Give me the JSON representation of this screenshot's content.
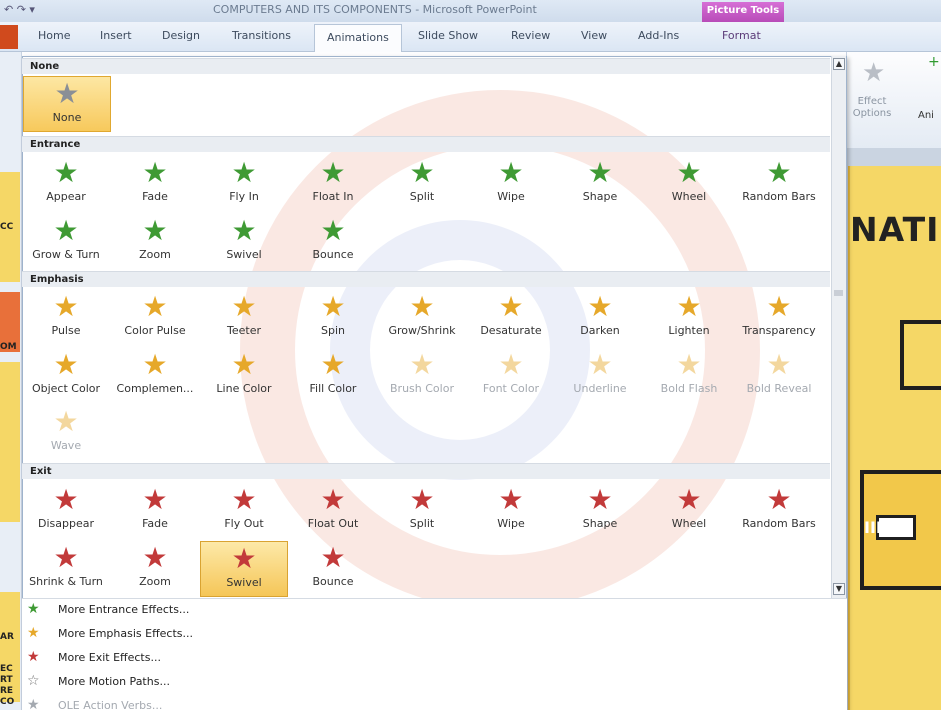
{
  "window": {
    "title": "COMPUTERS AND ITS COMPONENTS - Microsoft PowerPoint",
    "quick_access": "↶ ↷ ▾"
  },
  "context_tab": "Picture Tools",
  "tabs": [
    "Home",
    "Insert",
    "Design",
    "Transitions",
    "Animations",
    "Slide Show",
    "Review",
    "View",
    "Add-Ins",
    "Format"
  ],
  "active_tab": "Animations",
  "ribbon": {
    "effect_options_label": "Effect Options",
    "animation_label": "Ani"
  },
  "slide": {
    "title_fragment": "NATI",
    "tower_label": "IIII"
  },
  "left_fragments": [
    "CC",
    "OM",
    "AR",
    "EC",
    "RT",
    "RE",
    "CO"
  ],
  "gallery": {
    "none_header": "None",
    "none_item": "None",
    "entrance_header": "Entrance",
    "entrance": [
      "Appear",
      "Fade",
      "Fly In",
      "Float In",
      "Split",
      "Wipe",
      "Shape",
      "Wheel",
      "Random Bars",
      "Grow & Turn",
      "Zoom",
      "Swivel",
      "Bounce"
    ],
    "emphasis_header": "Emphasis",
    "emphasis": [
      "Pulse",
      "Color Pulse",
      "Teeter",
      "Spin",
      "Grow/Shrink",
      "Desaturate",
      "Darken",
      "Lighten",
      "Transparency",
      "Object Color",
      "Complemen...",
      "Line Color",
      "Fill Color",
      "Brush Color",
      "Font Color",
      "Underline",
      "Bold Flash",
      "Bold Reveal",
      "Wave"
    ],
    "exit_header": "Exit",
    "exit": [
      "Disappear",
      "Fade",
      "Fly Out",
      "Float Out",
      "Split",
      "Wipe",
      "Shape",
      "Wheel",
      "Random Bars",
      "Shrink & Turn",
      "Zoom",
      "Swivel",
      "Bounce"
    ],
    "hovered_item": "Swivel"
  },
  "menu": [
    {
      "label": "More Entrance Effects...",
      "icon": "entrance-star-icon",
      "color": "#3f9a34"
    },
    {
      "label": "More Emphasis Effects...",
      "icon": "emphasis-star-icon",
      "color": "#e6a82a"
    },
    {
      "label": "More Exit Effects...",
      "icon": "exit-star-icon",
      "color": "#c23a3a"
    },
    {
      "label": "More Motion Paths...",
      "icon": "motion-path-star-icon",
      "color": "#777777"
    },
    {
      "label": "OLE Action Verbs...",
      "icon": "ole-icon",
      "color": "#a4a9b0"
    }
  ]
}
